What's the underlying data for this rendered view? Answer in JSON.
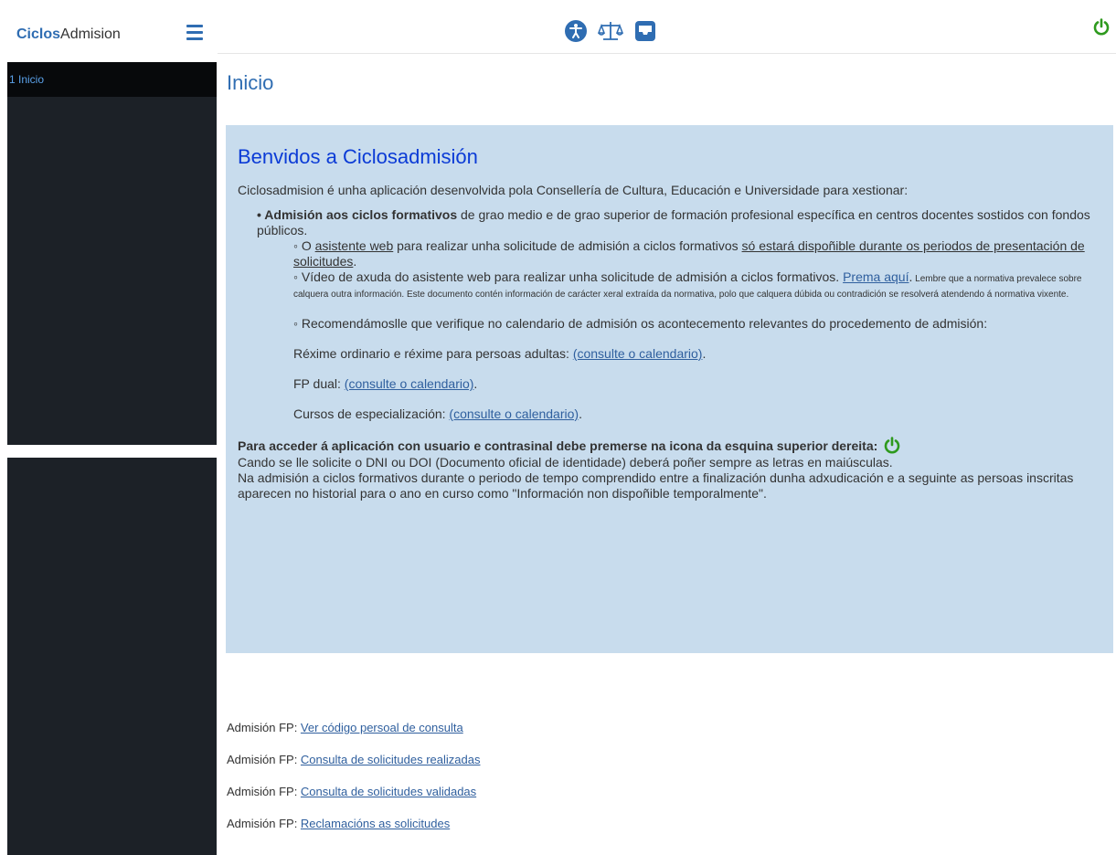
{
  "brand": {
    "accent": "Ciclos",
    "rest": "Admision"
  },
  "sidebar": {
    "items": [
      {
        "label": "1 Inicio"
      }
    ]
  },
  "header": {
    "icons": [
      "accessibility-icon",
      "balance-scale-icon",
      "inbox-icon"
    ],
    "power_icon": "power-icon"
  },
  "page": {
    "title": "Inicio"
  },
  "welcome": {
    "heading": "Benvidos a Ciclosadmisión",
    "intro": "Ciclosadmision é unha aplicación desenvolvida pola Consellería de  Cultura, Educación e Universidade para xestionar:",
    "bullet_bold": "Admisión aos ciclos formativos",
    "bullet_rest": " de grao medio e de grao superior de formación profesional específica en centros docentes sostidos con fondos públicos.",
    "sub1_pre": "O ",
    "sub1_link": "asistente web",
    "sub1_mid": " para realizar unha solicitude de admisión a ciclos formativos ",
    "sub1_link2": "só estará dispoñible durante os periodos de presentación de solicitudes",
    "sub1_end": ".",
    "sub2_text": "Vídeo de axuda do asistente web para realizar unha solicitude de admisión a ciclos formativos. ",
    "sub2_link": "Prema aquí",
    "sub2_dot": ".",
    "sub2_small": " Lembre que a normativa prevalece sobre calquera outra información. Este documento contén información de carácter xeral extraída da normativa, polo que calquera dúbida ou contradición se resolverá atendendo á normativa vixente.",
    "sub3_text": "Recomendámoslle que verifique no calendario de admisión os acontecemento relevantes do procedemento de admisión:",
    "cal1_label": "Réxime ordinario e réxime para persoas adultas: ",
    "cal2_label": "FP dual: ",
    "cal3_label": "Cursos de especialización: ",
    "cal_link": "(consulte o calendario)",
    "cal_dot": ".",
    "access_text": "Para acceder á aplicación con usuario e contrasinal debe premerse na icona da esquina superior dereita:",
    "dni_text": "Cando se lle solicite o DNI ou DOI (Documento oficial de identidade) deberá poñer sempre as letras en maiúsculas.",
    "note_text": "Na admisión a ciclos formativos durante o periodo de tempo comprendido entre a finalización dunha adxudicación e a seguinte as persoas inscritas aparecen no historial para o ano en curso  como \"Información non dispoñible temporalmente\"."
  },
  "links": {
    "prefix": "Admisión FP: ",
    "items": [
      {
        "label": "Ver código persoal de consulta"
      },
      {
        "label": "Consulta de solicitudes realizadas"
      },
      {
        "label": "Consulta de solicitudes validadas"
      },
      {
        "label": "Reclamacións as solicitudes"
      }
    ]
  },
  "colors": {
    "accent": "#2f6db2",
    "power": "#2e9a1e",
    "panel": "#c8dced",
    "sidebar": "#1c2127"
  }
}
